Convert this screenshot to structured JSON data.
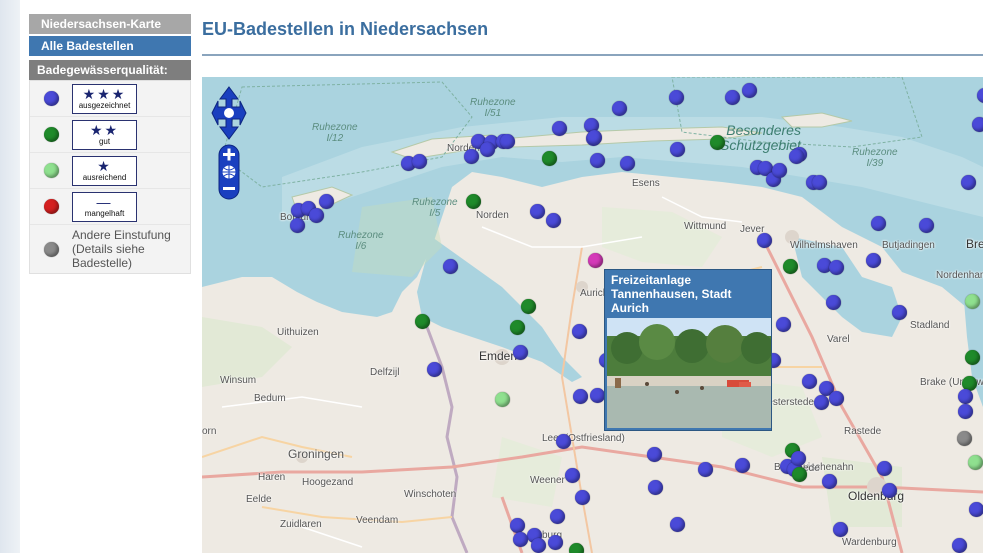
{
  "sidebar": {
    "map_button": "Niedersachsen-Karte",
    "all_button": "Alle Badestellen",
    "legend_title": "Badegewässerqualität:",
    "legend": [
      {
        "color": "#3f3fd6",
        "stars": "★★★",
        "label": "ausgezeichnet"
      },
      {
        "color": "#1f8a2a",
        "stars": "★★",
        "label": "gut"
      },
      {
        "color": "#8fe08f",
        "stars": "★",
        "label": "ausreichend"
      },
      {
        "color": "#d42020",
        "stars": "—",
        "label": "mangelhaft"
      },
      {
        "color": "#8a8a8a",
        "label": "Andere Einstufung (Details siehe Badestelle)"
      }
    ]
  },
  "page": {
    "title": "EU-Badestellen in Niedersachsen"
  },
  "map": {
    "places": {
      "ruhezone_i51": "Ruhezone\nI/51",
      "ruhezone_i12": "Ruhezone\nI/12",
      "ruhezone_i5": "Ruhezone\nI/5",
      "ruhezone_i6": "Ruhezone\nI/6",
      "ruhezone_i39": "Ruhezone\nI/39",
      "besonderes": "Besonderes\nSchutzgebiet",
      "norderney": "Norderney",
      "borkum": "Borkum",
      "norden": "Norden",
      "esens": "Esens",
      "wittmund": "Wittmund",
      "jever": "Jever",
      "wilhelmshaven": "Wilhelmshaven",
      "butjadingen": "Butjadingen",
      "aurich": "Aurich",
      "emden": "Emden",
      "uithuizen": "Uithuizen",
      "delfzijl": "Delfzijl",
      "winsum": "Winsum",
      "bedum": "Bedum",
      "groningen": "Groningen",
      "haren": "Haren",
      "hoogezand": "Hoogezand",
      "eelde": "Eelde",
      "winschoten": "Winschoten",
      "zuidlaren": "Zuidlaren",
      "veendam": "Veendam",
      "leer": "Leer (Ostfriesland)",
      "weener": "Weener",
      "bad_zwischenahn": "Bad Zwischenahn",
      "oldenburg": "Oldenburg",
      "westerstede": "Westerstede",
      "varel": "Varel",
      "rastede": "Rastede",
      "wardenburg": "Wardenburg",
      "brake": "Brake (Unterweser)",
      "stadland": "Stadland",
      "nordenham": "Nordenham",
      "bre": "Bre",
      "orn": "orn",
      "papenburg": "burg",
      "rhede": "nhede"
    },
    "popup": {
      "title": "Freizeitanlage Tannenhausen, Stadt Aurich"
    },
    "colors": {
      "excellent": "#4a4ad8",
      "good": "#1f8a2a",
      "sufficient": "#8fe08f",
      "poor": "#d42020",
      "other": "#8a8a8a",
      "selected": "#d43ab8",
      "sea": "#aad3df",
      "land": "#eeeae3"
    }
  }
}
